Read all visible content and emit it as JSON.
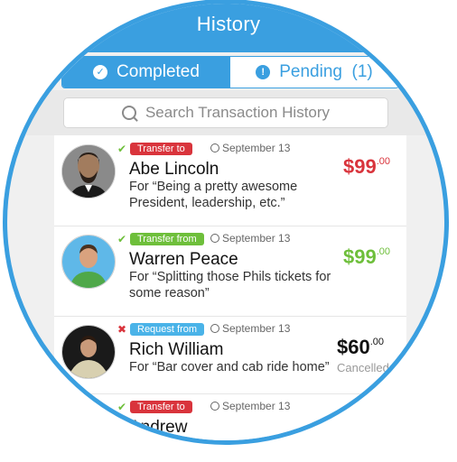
{
  "header": {
    "title": "History"
  },
  "tabs": [
    {
      "label": "Completed",
      "icon": "check-circle-icon",
      "active": true
    },
    {
      "label": "Pending  (1)",
      "icon": "exclamation-circle-icon",
      "active": false
    }
  ],
  "search": {
    "placeholder": "Search Transaction History"
  },
  "colors": {
    "accent": "#3a9fe0",
    "red": "#d9343c",
    "green": "#6ebf3b",
    "blue_badge": "#4ab3e8"
  },
  "transactions": [
    {
      "status": "completed",
      "status_icon": "check-icon",
      "badge": "Transfer to",
      "date": "September 13",
      "name": "Abe Lincoln",
      "description": "For “Being a pretty awesome President, leadership, etc.”",
      "amount_main": "$99",
      "amount_cents": ".00"
    },
    {
      "status": "completed",
      "status_icon": "check-icon",
      "badge": "Transfer from",
      "date": "September 13",
      "name": "Warren Peace",
      "description": "For “Splitting those Phils tickets for some reason”",
      "amount_main": "$99",
      "amount_cents": ".00"
    },
    {
      "status": "cancelled",
      "status_icon": "x-icon",
      "badge": "Request from",
      "date": "September 13",
      "name": "Rich William",
      "description": "For “Bar cover and cab ride home”",
      "amount_main": "$60",
      "amount_cents": ".00",
      "substatus": "Cancelled"
    },
    {
      "status": "completed",
      "status_icon": "check-icon",
      "badge": "Transfer to",
      "date": "September 13",
      "name": "Andrew"
    }
  ]
}
